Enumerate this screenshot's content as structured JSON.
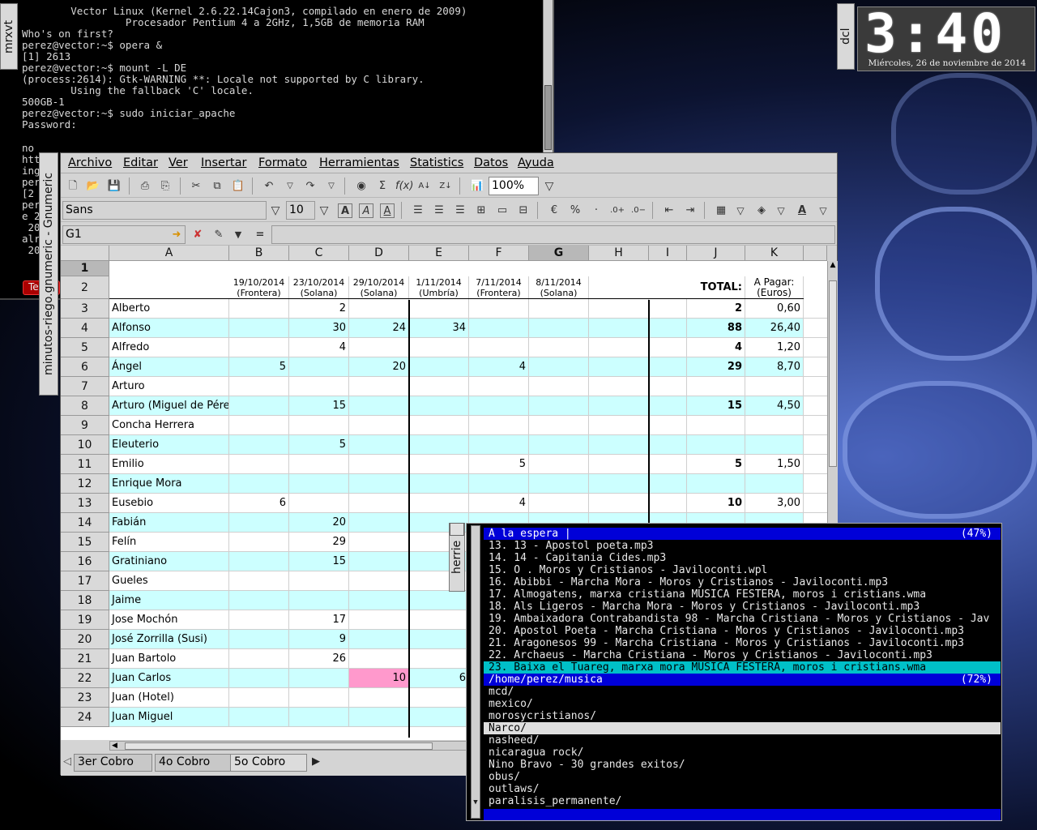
{
  "terminal": {
    "tab_label": "mrxvt",
    "lines": [
      "        Vector Linux (Kernel 2.6.22.14Cajon3, compilado en enero de 2009)",
      "                 Procesador Pentium 4 a 2GHz, 1,5GB de memoria RAM",
      "",
      "Who's on first?",
      "",
      "perez@vector:~$ opera &",
      "[1] 2613",
      "perez@vector:~$ mount -L DE",
      "(process:2614): Gtk-WARNING **: Locale not supported by C library.",
      "        Using the fallback 'C' locale.",
      "500GB-1",
      "perez@vector:~$ sudo iniciar_apache",
      "Password:"
    ],
    "peek_lines": [
      "no",
      "htt",
      "ing",
      "per",
      "[2",
      "per",
      "e 2",
      " 20",
      "alr",
      " 20"
    ],
    "peek_button": "Te"
  },
  "clock": {
    "tab_label": "dcl",
    "time": "3:40",
    "date": "Miércoles, 26 de noviembre de 2014"
  },
  "gnumeric": {
    "window_tab": "minutos-riego.gnumeric - Gnumeric",
    "menu": [
      "Archivo",
      "Editar",
      "Ver",
      "Insertar",
      "Formato",
      "Herramientas",
      "Statistics",
      "Datos",
      "Ayuda"
    ],
    "zoom": "100%",
    "font": "Sans",
    "font_size": "10",
    "cell_ref": "G1",
    "formula_eq": "=",
    "formula": "",
    "columns": [
      "A",
      "B",
      "C",
      "D",
      "E",
      "F",
      "G",
      "H",
      "I",
      "J",
      "K"
    ],
    "selected_column": "G",
    "date_headers": [
      {
        "col": "B",
        "date": "19/10/2014",
        "place": "(Frontera)"
      },
      {
        "col": "C",
        "date": "23/10/2014",
        "place": "(Solana)"
      },
      {
        "col": "D",
        "date": "29/10/2014",
        "place": "(Solana)"
      },
      {
        "col": "E",
        "date": "1/11/2014",
        "place": "(Umbría)"
      },
      {
        "col": "F",
        "date": "7/11/2014",
        "place": "(Frontera)"
      },
      {
        "col": "G",
        "date": "8/11/2014",
        "place": "(Solana)"
      }
    ],
    "total_header": "TOTAL:",
    "pay_header_1": "A Pagar:",
    "pay_header_2": "(Euros)",
    "rows": [
      {
        "n": "3",
        "name": "Alberto",
        "B": "",
        "C": "2",
        "D": "",
        "E": "",
        "F": "",
        "G": "",
        "J": "2",
        "K": "0,60"
      },
      {
        "n": "4",
        "name": "Alfonso",
        "B": "",
        "C": "30",
        "D": "24",
        "E": "34",
        "F": "",
        "G": "",
        "J": "88",
        "K": "26,40"
      },
      {
        "n": "5",
        "name": "Alfredo",
        "B": "",
        "C": "4",
        "D": "",
        "E": "",
        "F": "",
        "G": "",
        "J": "4",
        "K": "1,20"
      },
      {
        "n": "6",
        "name": "Ángel",
        "B": "5",
        "C": "",
        "D": "20",
        "E": "",
        "F": "4",
        "G": "",
        "J": "29",
        "K": "8,70"
      },
      {
        "n": "7",
        "name": "Arturo",
        "B": "",
        "C": "",
        "D": "",
        "E": "",
        "F": "",
        "G": "",
        "J": "",
        "K": ""
      },
      {
        "n": "8",
        "name": "Arturo (Miguel de Pérez)",
        "B": "",
        "C": "15",
        "D": "",
        "E": "",
        "F": "",
        "G": "",
        "J": "15",
        "K": "4,50"
      },
      {
        "n": "9",
        "name": "Concha Herrera",
        "B": "",
        "C": "",
        "D": "",
        "E": "",
        "F": "",
        "G": "",
        "J": "",
        "K": ""
      },
      {
        "n": "10",
        "name": "Eleuterio",
        "B": "",
        "C": "5",
        "D": "",
        "E": "",
        "F": "",
        "G": "",
        "J": "",
        "K": ""
      },
      {
        "n": "11",
        "name": "Emilio",
        "B": "",
        "C": "",
        "D": "",
        "E": "",
        "F": "5",
        "G": "",
        "J": "5",
        "K": "1,50"
      },
      {
        "n": "12",
        "name": "Enrique Mora",
        "B": "",
        "C": "",
        "D": "",
        "E": "",
        "F": "",
        "G": "",
        "J": "",
        "K": ""
      },
      {
        "n": "13",
        "name": "Eusebio",
        "B": "6",
        "C": "",
        "D": "",
        "E": "",
        "F": "4",
        "G": "",
        "J": "10",
        "K": "3,00"
      },
      {
        "n": "14",
        "name": "Fabián",
        "B": "",
        "C": "20",
        "D": "",
        "E": "",
        "F": "",
        "G": "",
        "J": "",
        "K": ""
      },
      {
        "n": "15",
        "name": "Felín",
        "B": "",
        "C": "29",
        "D": "",
        "E": "",
        "F": "",
        "G": "",
        "J": "",
        "K": ""
      },
      {
        "n": "16",
        "name": "Gratiniano",
        "B": "",
        "C": "15",
        "D": "",
        "E": "",
        "F": "",
        "G": "",
        "J": "",
        "K": ""
      },
      {
        "n": "17",
        "name": "Gueles",
        "B": "",
        "C": "",
        "D": "",
        "E": "",
        "F": "",
        "G": "",
        "J": "",
        "K": ""
      },
      {
        "n": "18",
        "name": "Jaime",
        "B": "",
        "C": "",
        "D": "",
        "E": "",
        "F": "",
        "G": "",
        "J": "",
        "K": ""
      },
      {
        "n": "19",
        "name": "Jose Mochón",
        "B": "",
        "C": "17",
        "D": "",
        "E": "",
        "F": "",
        "G": "",
        "J": "",
        "K": ""
      },
      {
        "n": "20",
        "name": "José Zorrilla (Susi)",
        "B": "",
        "C": "9",
        "D": "",
        "E": "",
        "F": "",
        "G": "",
        "J": "",
        "K": ""
      },
      {
        "n": "21",
        "name": "Juan Bartolo",
        "B": "",
        "C": "26",
        "D": "",
        "E": "",
        "F": "",
        "G": "",
        "J": "",
        "K": ""
      },
      {
        "n": "22",
        "name": "Juan Carlos",
        "B": "",
        "C": "",
        "D": "10",
        "E": "6",
        "F": "",
        "G": "",
        "J": "",
        "K": ""
      },
      {
        "n": "23",
        "name": "Juan (Hotel)",
        "B": "",
        "C": "",
        "D": "",
        "E": "",
        "F": "",
        "G": "",
        "J": "",
        "K": ""
      },
      {
        "n": "24",
        "name": "Juan Miguel",
        "B": "",
        "C": "",
        "D": "",
        "E": "",
        "F": "",
        "G": "",
        "J": "",
        "K": ""
      }
    ],
    "sheet_tabs": [
      "3er Cobro",
      "4o Cobro",
      "5o Cobro"
    ],
    "colors": {
      "stripe": "#ccffff",
      "highlight": "#ff99cc",
      "menu_bg": "#d4d4d4"
    }
  },
  "herrie": {
    "tab_label": "herrie",
    "queue_title": "A la espera |",
    "queue_pct": "(47%)",
    "queue": [
      "13. 13 - Apostol poeta.mp3",
      "14. 14 - Capitania Cides.mp3",
      "15. O . Moros y Cristianos - Javiloconti.wpl",
      "16. Abibbi - Marcha Mora - Moros y Cristianos - Javiloconti.mp3",
      "17. Almogatens, marxa cristiana MUSICA FESTERA, moros i cristians.wma",
      "18. Als Ligeros - Marcha Mora - Moros y Cristianos - Javiloconti.mp3",
      "19. Ambaixadora Contrabandista 98 - Marcha Cristiana - Moros y Cristianos - Jav",
      "20. Apostol Poeta - Marcha Cristiana - Moros y Cristianos - Javiloconti.mp3",
      "21. Aragonesos 99 - Marcha Cristiana - Moros y Cristianos - Javiloconti.mp3",
      "22. Archaeus - Marcha Cristiana - Moros y Cristianos - Javiloconti.mp3",
      "23. Baixa el Tuareg, marxa mora MUSICA FESTERA, moros i cristians.wma"
    ],
    "browser_title": "/home/perez/musica",
    "browser_pct": "(72%)",
    "browser": [
      "mcd/",
      "mexico/",
      "morosycristianos/",
      "Narco/",
      "nasheed/",
      "nicaragua rock/",
      "Nino Bravo - 30 grandes exitos/",
      "obus/",
      "outlaws/",
      "paralisis_permanente/"
    ],
    "selected_browser_item": "Narco/"
  }
}
